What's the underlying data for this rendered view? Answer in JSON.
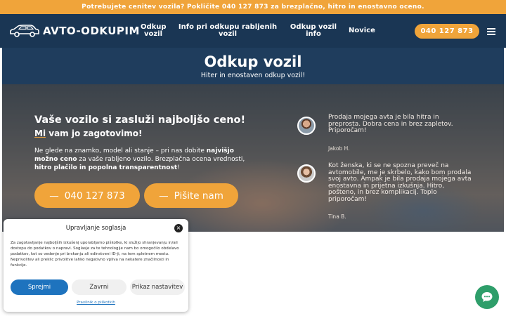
{
  "topbar": {
    "text": "Potrebujete cenitev vozila? Pokličite 040 127 873 za brezplačno, hitro in enostavno oceno."
  },
  "header": {
    "logo_text": "AVTO-ODKUPIM",
    "menu": [
      {
        "label": "Odkup vozil"
      },
      {
        "label": "Info pri odkupu rabljenih vozil"
      },
      {
        "label": "Odkup vozil info"
      },
      {
        "label": "Novice"
      }
    ],
    "phone": "040 127 873"
  },
  "title_section": {
    "title": "Odkup vozil",
    "subtitle": "Hiter in enostaven odkup vozil!"
  },
  "hero": {
    "heading": "Vaše vozilo si zasluži najboljšo ceno!",
    "subheading_underlined": "Mi",
    "subheading_rest": " vam jo zagotovimo!",
    "paragraph": {
      "p1": "Ne glede na znamko, model ali stanje – pri nas dobite ",
      "b1": "najvišjo možno ceno",
      "p2": " za vaše rabljeno vozilo. Brezplačna ocena vrednosti, ",
      "b2": "hitro plačilo in popolna transparentnost",
      "p3": "!"
    },
    "button_phone": "040 127 873",
    "button_write": "Pišite nam",
    "button_dash": "—"
  },
  "testimonials": [
    {
      "text": "Prodaja mojega avta je bila hitra in preprosta. Dobra cena in brez zapletov. Priporočam!",
      "name": "Jakob H."
    },
    {
      "text": "Kot ženska, ki se ne spozna preveč na avtomobile, me je skrbelo, kako bom prodala svoj avto. Ampak je bila prodaja mojega avta enostavna in prijetna izkušnja. Hitro, pošteno, in brez komplikacij. Toplo priporočam!",
      "name": "Tina B."
    }
  ],
  "consent": {
    "title": "Upravljanje soglasja",
    "body": "Za zagotavljanje najboljših izkušenj uporabljamo piškotke, ki služijo shranjevanju in/ali dostopu do podatkov o napravi. Soglasje za te tehnologije nam bo omogočilo obdelavo podatkov, kot so vedenje pri brskanju ali edinstveni ID-ji, na tem spletnem mestu. Neprivolitev ali preklic privolitve lahko negativno vpliva na nekatere značilnosti in funkcije.",
    "accept": "Sprejmi",
    "deny": "Zavrni",
    "preferences": "Prikaz nastavitev",
    "link": "Pravilnik o piškotkih",
    "close": "×"
  },
  "colors": {
    "accent": "#f0a43a",
    "navy": "#1a3654",
    "consent_blue": "#1e73be",
    "chat_green": "#2e9e6a"
  },
  "icons": {
    "logo": "car-outline-icon",
    "menu": "hamburger-icon",
    "close": "close-icon",
    "chat": "chat-icon"
  }
}
